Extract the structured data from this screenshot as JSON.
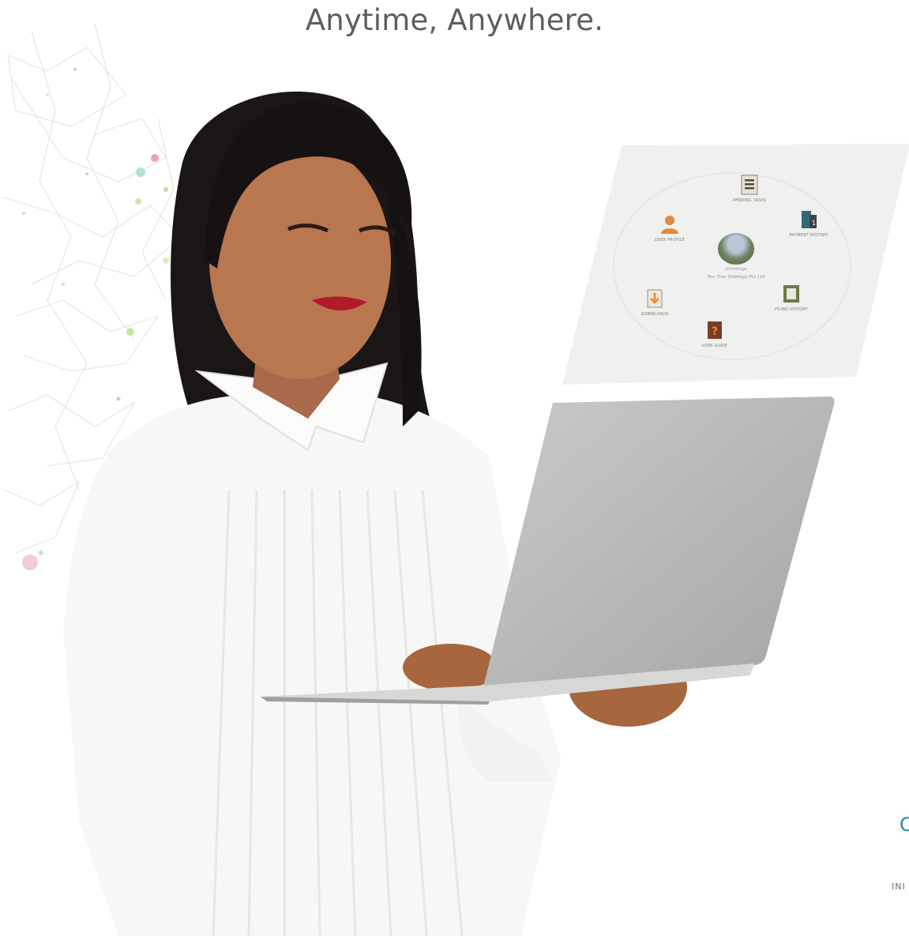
{
  "header": {
    "tagline": "Anytime, Anywhere."
  },
  "dashboard_panel": {
    "items": [
      {
        "label": "PENDING TASKS",
        "icon": "pending-tasks-icon"
      },
      {
        "label": "PAYMENT HISTORY",
        "icon": "payment-history-icon"
      },
      {
        "label": "FILING HISTORY",
        "icon": "filing-history-icon"
      },
      {
        "label": "USER GUIDE",
        "icon": "user-guide-icon"
      },
      {
        "label": "DOWNLOADS",
        "icon": "downloads-icon"
      },
      {
        "label": "USER PROFILE",
        "icon": "user-profile-icon"
      }
    ],
    "greeting": "Greetings",
    "company": "Tea Tree Holdings Pvt Ltd"
  },
  "brand": {
    "partial_logo": "C",
    "partial_subtitle": "INI"
  },
  "colors": {
    "brand_teal": "#1f8da0",
    "tagline_gray": "#5d5d5d",
    "accent_orange": "#e8883a"
  }
}
